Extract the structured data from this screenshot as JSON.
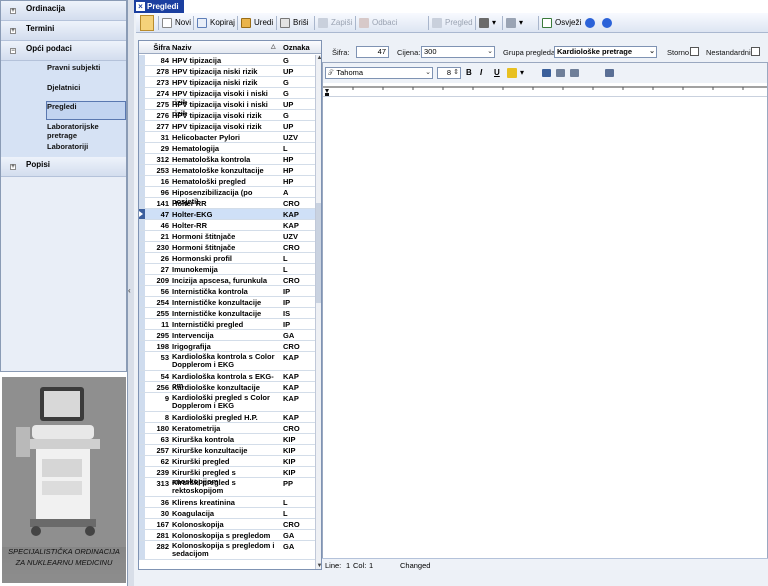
{
  "nav": {
    "groups": [
      {
        "label": "Ordinacija",
        "expand": "+"
      },
      {
        "label": "Termini",
        "expand": "+"
      },
      {
        "label": "Opći podaci",
        "expand": "−"
      },
      {
        "label": "Popisi",
        "expand": "+"
      }
    ],
    "subitems": [
      "Pravni subjekti",
      "Djelatnici",
      "Pregledi",
      "Laboratorijske pretrage",
      "Laboratoriji"
    ],
    "selected": "Pregledi",
    "image_caption_line1": "SPECIJALISTIČKA ORDINACIJA",
    "image_caption_line2": "ZA NUKLEARNU MEDICINU"
  },
  "window": {
    "title": "Pregledi"
  },
  "toolbar": {
    "novi": "Novi",
    "kopiraj": "Kopiraj",
    "uredi": "Uredi",
    "brisi": "Briši",
    "zapisi": "Zapiši",
    "odbaci": "Odbaci",
    "preglet": "Pregled",
    "osvjezi": "Osvježi"
  },
  "grid": {
    "headers": {
      "sifra": "Šifra",
      "naziv": "Naziv",
      "oznaka": "Oznaka"
    },
    "rows": [
      {
        "sifra": "84",
        "naziv": "HPV tipizacija",
        "oznaka": "G"
      },
      {
        "sifra": "278",
        "naziv": "HPV tipizacija niski rizik",
        "oznaka": "UP"
      },
      {
        "sifra": "273",
        "naziv": "HPV tipizacija niski rizik",
        "oznaka": "G"
      },
      {
        "sifra": "274",
        "naziv": "HPV tipizacija visoki i niski rizik",
        "oznaka": "G"
      },
      {
        "sifra": "275",
        "naziv": "HPV tipizacija visoki i niski rizik",
        "oznaka": "UP"
      },
      {
        "sifra": "276",
        "naziv": "HPV tipizacija visoki rizik",
        "oznaka": "G"
      },
      {
        "sifra": "277",
        "naziv": "HPV tipizacija visoki rizik",
        "oznaka": "UP"
      },
      {
        "sifra": "31",
        "naziv": "Helicobacter Pylori",
        "oznaka": "UZV"
      },
      {
        "sifra": "29",
        "naziv": "Hematologija",
        "oznaka": "L"
      },
      {
        "sifra": "312",
        "naziv": "Hematološka kontrola",
        "oznaka": "HP"
      },
      {
        "sifra": "253",
        "naziv": "Hematološke konzultacije",
        "oznaka": "HP"
      },
      {
        "sifra": "16",
        "naziv": "Hematološki pregled",
        "oznaka": "HP"
      },
      {
        "sifra": "96",
        "naziv": "Hiposenzibilizacija (po posjeti)",
        "oznaka": "A"
      },
      {
        "sifra": "141",
        "naziv": "Holter RR",
        "oznaka": "CRO"
      },
      {
        "sifra": "47",
        "naziv": "Holter-EKG",
        "oznaka": "KAP",
        "selected": true
      },
      {
        "sifra": "46",
        "naziv": "Holter-RR",
        "oznaka": "KAP"
      },
      {
        "sifra": "21",
        "naziv": "Hormoni štitnjače",
        "oznaka": "UZV"
      },
      {
        "sifra": "230",
        "naziv": "Hormoni štitnjače",
        "oznaka": "CRO"
      },
      {
        "sifra": "26",
        "naziv": "Hormonski profil",
        "oznaka": "L"
      },
      {
        "sifra": "27",
        "naziv": "Imunokemija",
        "oznaka": "L"
      },
      {
        "sifra": "209",
        "naziv": "Incizija apscesa, furunkula",
        "oznaka": "CRO"
      },
      {
        "sifra": "56",
        "naziv": "Internistička kontrola",
        "oznaka": "IP"
      },
      {
        "sifra": "254",
        "naziv": "Internističke konzultacije",
        "oznaka": "IP"
      },
      {
        "sifra": "255",
        "naziv": "Internističke konzultacije",
        "oznaka": "IS"
      },
      {
        "sifra": "11",
        "naziv": "Internistički pregled",
        "oznaka": "IP"
      },
      {
        "sifra": "295",
        "naziv": "Intervencija",
        "oznaka": "GA"
      },
      {
        "sifra": "198",
        "naziv": "Irigografija",
        "oznaka": "CRO"
      },
      {
        "sifra": "53",
        "naziv": "Kardiološka kontrola s Color Dopplerom i EKG",
        "oznaka": "KAP",
        "tall": true
      },
      {
        "sifra": "54",
        "naziv": "Kardiološka kontrola s EKG-om",
        "oznaka": "KAP"
      },
      {
        "sifra": "256",
        "naziv": "Kardiološke konzultacije",
        "oznaka": "KAP"
      },
      {
        "sifra": "9",
        "naziv": "Kardiološki pregled s Color Dopplerom i EKG",
        "oznaka": "KAP",
        "tall": true
      },
      {
        "sifra": "8",
        "naziv": "Kardiološki pregled H.P.",
        "oznaka": "KAP"
      },
      {
        "sifra": "180",
        "naziv": "Keratometrija",
        "oznaka": "CRO"
      },
      {
        "sifra": "63",
        "naziv": "Kirurška kontrola",
        "oznaka": "KIP"
      },
      {
        "sifra": "257",
        "naziv": "Kirurške konzultacije",
        "oznaka": "KIP"
      },
      {
        "sifra": "62",
        "naziv": "Kirurški pregled",
        "oznaka": "KIP"
      },
      {
        "sifra": "239",
        "naziv": "Kirurški pregled s anoskopijom",
        "oznaka": "KIP"
      },
      {
        "sifra": "313",
        "naziv": "Kirurški pregled s rektoskopijom",
        "oznaka": "PP",
        "tall": true
      },
      {
        "sifra": "36",
        "naziv": "Klirens kreatinina",
        "oznaka": "L"
      },
      {
        "sifra": "30",
        "naziv": "Koagulacija",
        "oznaka": "L"
      },
      {
        "sifra": "167",
        "naziv": "Kolonoskopija",
        "oznaka": "CRO"
      },
      {
        "sifra": "281",
        "naziv": "Kolonoskopija s pregledom",
        "oznaka": "GA"
      },
      {
        "sifra": "282",
        "naziv": "Kolonoskopija s pregledom i sedacijom",
        "oznaka": "GA",
        "tall": true
      }
    ]
  },
  "form": {
    "sifra_label": "Šifra:",
    "sifra_value": "47",
    "cijena_label": "Cijena:",
    "cijena_value": "300",
    "grupa_label": "Grupa pregleda:",
    "grupa_value": "Kardiološke pretrage",
    "storno_label": "Storno",
    "nestandardni_label": "Nestandardni"
  },
  "editor": {
    "font": "Tahoma",
    "size": "8"
  },
  "status": {
    "line": "Line:",
    "line_value": "1",
    "col": "Col:",
    "col_value": "1",
    "state": "Changed"
  },
  "colors": {
    "title_bg": "#1b3fa0",
    "nav_bg": "#e9eef7",
    "selected_row": "#cfe0f7"
  }
}
